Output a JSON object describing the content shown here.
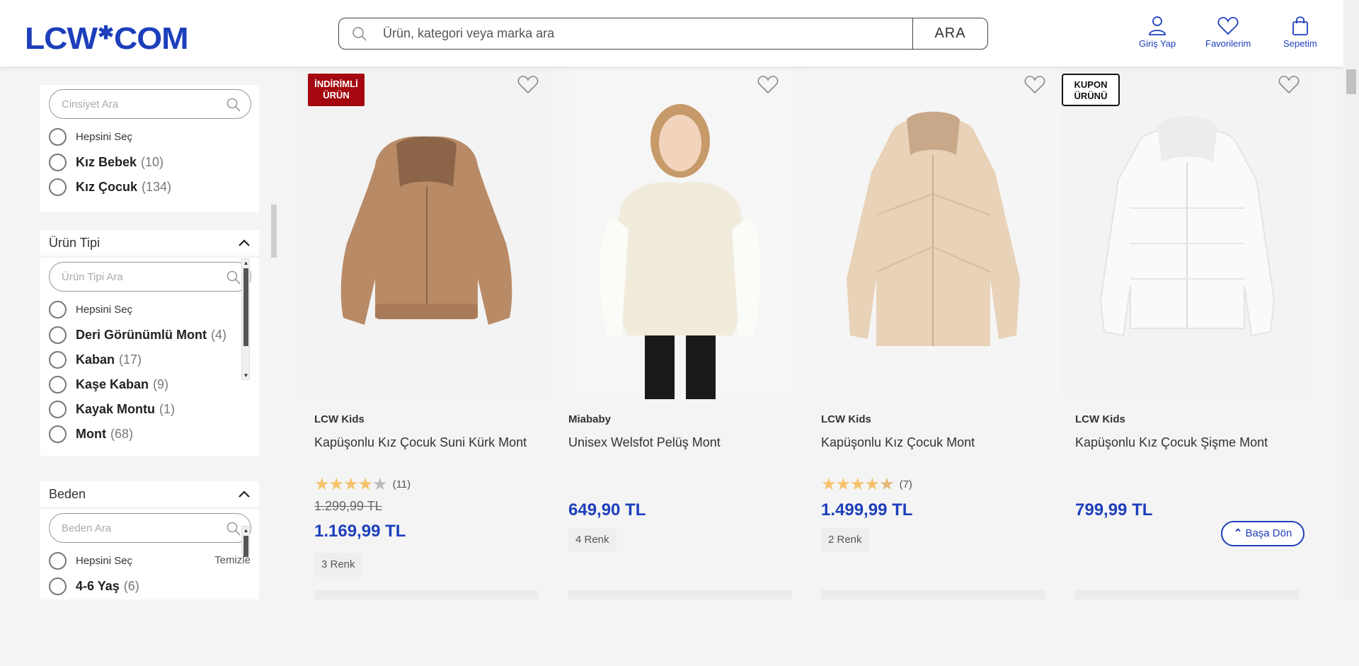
{
  "header": {
    "logo": "LCW",
    "logo_suffix": "COM",
    "search_placeholder": "Ürün, kategori veya marka ara",
    "search_button": "ARA",
    "login_label": "Giriş Yap",
    "favorites_label": "Favorilerim",
    "cart_label": "Sepetim",
    "accent_color": "#1d3fbb"
  },
  "sidebar": {
    "gender": {
      "search_placeholder": "Cinsiyet Ara",
      "select_all": "Hepsini Seç",
      "options": [
        {
          "label": "Kız Bebek",
          "count": "(10)"
        },
        {
          "label": "Kız Çocuk",
          "count": "(134)"
        }
      ]
    },
    "product_type": {
      "title": "Ürün Tipi",
      "search_placeholder": "Ürün Tipi Ara",
      "select_all": "Hepsini Seç",
      "options": [
        {
          "label": "Deri Görünümlü Mont",
          "count": "(4)"
        },
        {
          "label": "Kaban",
          "count": "(17)"
        },
        {
          "label": "Kaşe Kaban",
          "count": "(9)"
        },
        {
          "label": "Kayak Montu",
          "count": "(1)"
        },
        {
          "label": "Mont",
          "count": "(68)"
        }
      ]
    },
    "size": {
      "title": "Beden",
      "search_placeholder": "Beden Ara",
      "select_all": "Hepsini Seç",
      "clear": "Temizle",
      "options": [
        {
          "label": "4-6 Yaş",
          "count": "(6)"
        }
      ]
    }
  },
  "products": [
    {
      "badge": "İNDİRİMLİ ÜRÜN",
      "brand": "LCW Kids",
      "name": "Kapüşonlu Kız Çocuk Suni Kürk Mont",
      "rating_count": "(11)",
      "stars": 4,
      "old_price": "1.299,99 TL",
      "price": "1.169,99 TL",
      "colors": "3 Renk"
    },
    {
      "brand": "Miababy",
      "name": "Unisex Welsfot Pelüş Mont",
      "price": "649,90 TL",
      "colors": "4 Renk"
    },
    {
      "brand": "LCW Kids",
      "name": "Kapüşonlu Kız Çocuk Mont",
      "rating_count": "(7)",
      "stars": 4.5,
      "price": "1.499,99 TL",
      "colors": "2 Renk"
    },
    {
      "badge": "KUPON ÜRÜNÜ",
      "brand": "LCW Kids",
      "name": "Kapüşonlu Kız Çocuk Şişme Mont",
      "price": "799,99 TL"
    }
  ],
  "back_to_top": "Başa Dön",
  "icons": [
    "search-icon",
    "user-icon",
    "heart-icon",
    "bag-icon",
    "chevron-up-icon",
    "arrow-up-icon"
  ]
}
